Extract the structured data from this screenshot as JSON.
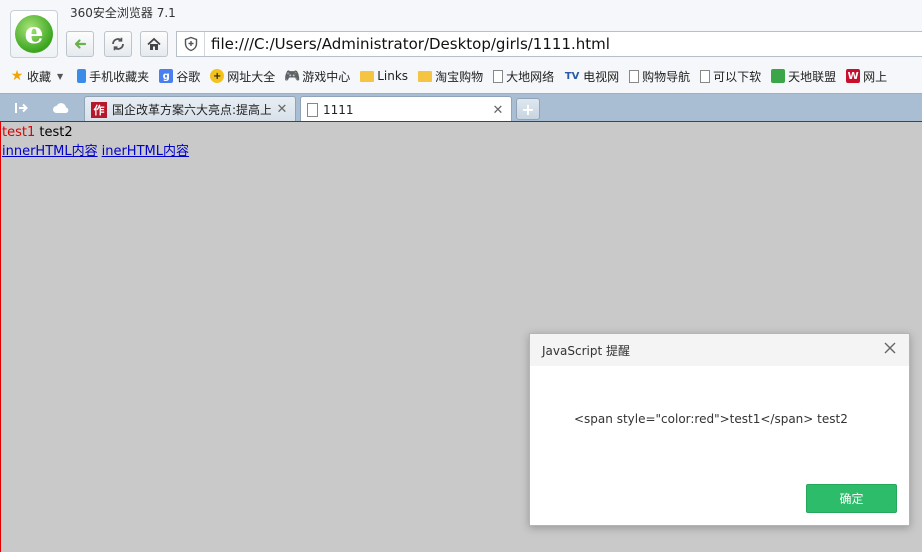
{
  "window": {
    "title": "360安全浏览器 7.1"
  },
  "address": {
    "url": "file:///C:/Users/Administrator/Desktop/girls/1111.html"
  },
  "bookmarks": {
    "favorites_label": "收藏",
    "items": [
      "手机收藏夹",
      "谷歌",
      "网址大全",
      "游戏中心",
      "Links",
      "淘宝购物",
      "大地网络",
      "电视网",
      "购物导航",
      "可以下软",
      "天地联盟",
      "网上"
    ]
  },
  "tabs": [
    {
      "label": "国企改革方案六大亮点:提高上",
      "close": "✕"
    },
    {
      "label": "1111",
      "close": "✕"
    }
  ],
  "newtab_label": "+",
  "page": {
    "test1": "test1",
    "test2": "test2",
    "link1": "innerHTML内容",
    "link2": "inerHTML内容"
  },
  "dialog": {
    "title": "JavaScript 提醒",
    "message": "<span style=\"color:red\">test1</span> test2",
    "ok_label": "确定"
  },
  "colors": {
    "ok_button": "#2dbd6a",
    "tabstrip": "#a9bed3",
    "viewport": "#c9c9c9",
    "red_text": "#e00000"
  }
}
